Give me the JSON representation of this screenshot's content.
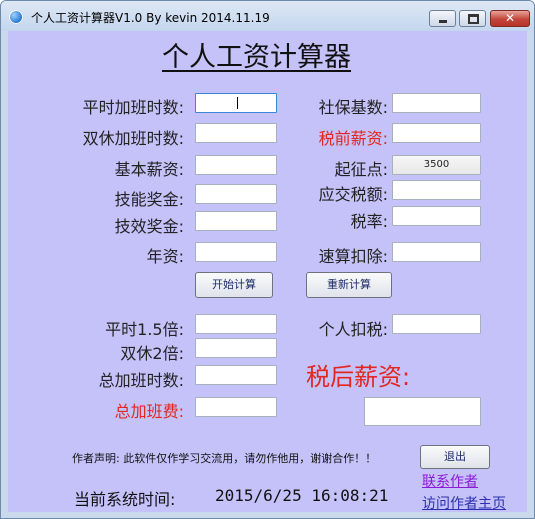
{
  "window": {
    "title": "个人工资计算器V1.0 By kevin 2014.11.19",
    "close_glyph": "✕"
  },
  "app": {
    "heading": "个人工资计算器"
  },
  "fields": {
    "weekday_overtime_label": "平时加班时数:",
    "weekend_overtime_label": "双休加班时数:",
    "base_salary_label": "基本薪资:",
    "skill_bonus_label": "技能奖金:",
    "performance_bonus_label": "技效奖金:",
    "seniority_pay_label": "年资:",
    "social_security_base_label": "社保基数:",
    "pretax_salary_label": "税前薪资:",
    "threshold_label": "起征点:",
    "threshold_value": "3500",
    "taxable_amount_label": "应交税额:",
    "tax_rate_label": "税率:",
    "quick_deduction_label": "速算扣除:",
    "weekday_15x_label": "平时1.5倍:",
    "weekend_2x_label": "双休2倍:",
    "total_overtime_hours_label": "总加班时数:",
    "total_overtime_pay_label": "总加班费:",
    "personal_tax_label": "个人扣税:",
    "after_tax_salary_label": "税后薪资:"
  },
  "buttons": {
    "calculate": "开始计算",
    "recalculate": "重新计算",
    "exit": "退出"
  },
  "footer": {
    "note": "作者声明: 此软件仅作学习交流用，请勿作他用，谢谢合作！！",
    "contact_link": "联系作者",
    "homepage_link": "访问作者主页",
    "clock_label": "当前系统时间:",
    "clock_value": "2015/6/25 16:08:21"
  },
  "colors": {
    "client_background": "#c5c2fa",
    "emphasis_red": "#e3261f",
    "link_purple": "#8a1bd6"
  },
  "icons": {
    "app": "app-icon",
    "minimize": "minimize-icon",
    "maximize": "maximize-icon",
    "close": "close-icon"
  }
}
